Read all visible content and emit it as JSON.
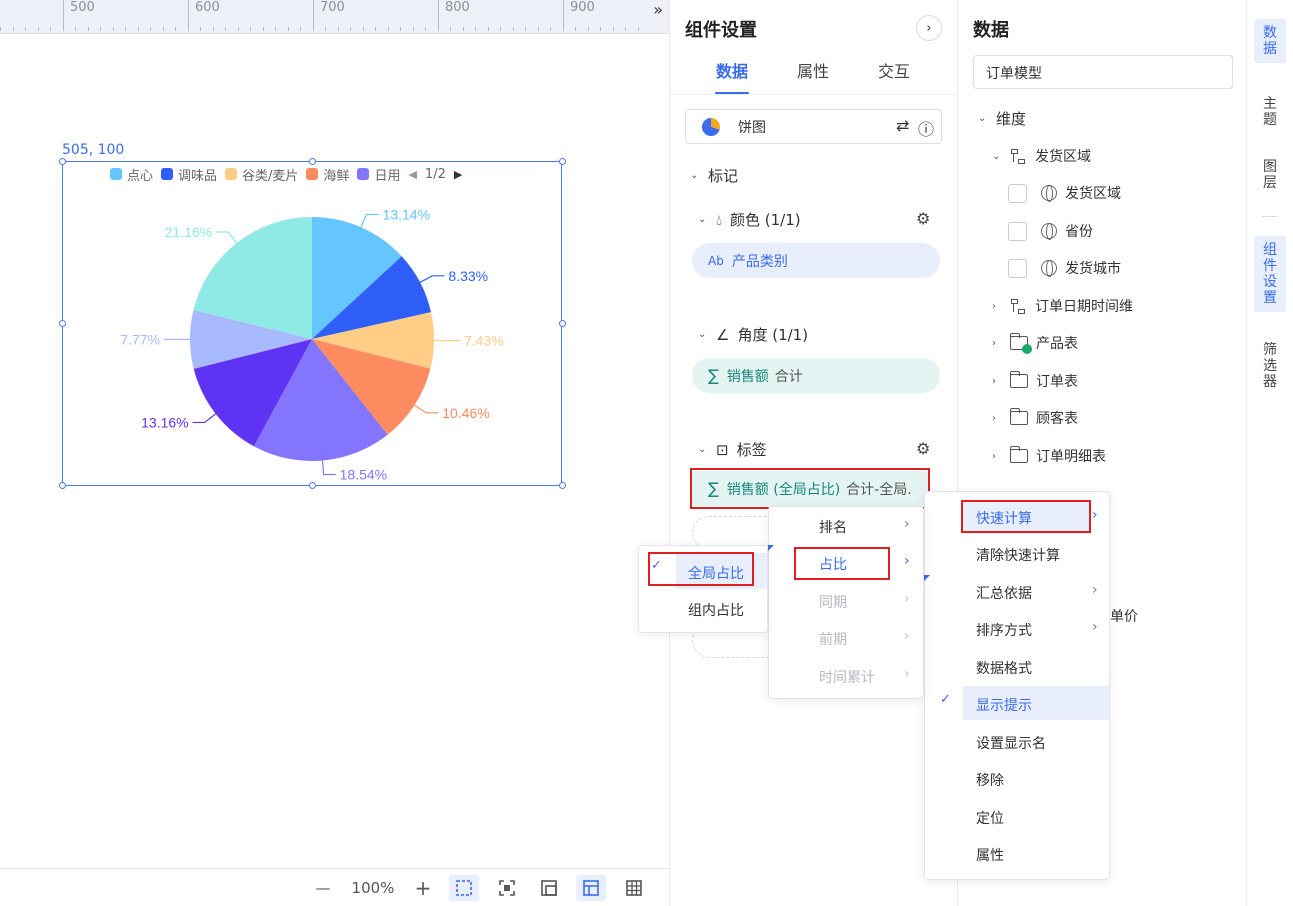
{
  "ruler": {
    "labels": [
      "500",
      "600",
      "700",
      "800",
      "900"
    ],
    "collapse_label": "»"
  },
  "canvas": {
    "selection_coords": "505, 100",
    "legend": {
      "items": [
        {
          "label": "点心",
          "color": "#64c6fd"
        },
        {
          "label": "调味品",
          "color": "#2f5ff8"
        },
        {
          "label": "谷类/麦片",
          "color": "#ffcd85"
        },
        {
          "label": "海鲜",
          "color": "#ff8c60"
        },
        {
          "label": "日用",
          "color": "#8475fd"
        }
      ],
      "page": "1/2"
    }
  },
  "chart_data": {
    "type": "pie",
    "values": [
      13.14,
      8.33,
      7.43,
      10.46,
      18.54,
      13.16,
      7.77,
      21.16
    ],
    "labels": [
      "13.14%",
      "8.33%",
      "7.43%",
      "10.46%",
      "18.54%",
      "13.16%",
      "7.77%",
      "21.16%"
    ],
    "colors": [
      "#64c6fd",
      "#2f5ff8",
      "#ffcd85",
      "#ff8c60",
      "#8475fd",
      "#5f33f4",
      "#a9b9fd",
      "#8fe9e5"
    ],
    "legend_placement": "top"
  },
  "bottombar": {
    "zoom": "100%",
    "minus": "—",
    "plus": "+"
  },
  "component_panel": {
    "title": "组件设置",
    "collapse": "›",
    "tabs": [
      "数据",
      "属性",
      "交互"
    ],
    "chart_type": "饼图",
    "marks_label": "标记",
    "color_section": "颜色 (1/1)",
    "color_field": "产品类别",
    "color_field_prefix": "Ab",
    "angle_section": "角度 (1/1)",
    "angle_field": "销售额",
    "angle_agg": "合计",
    "label_section": "标签",
    "label_field": "销售额 (全局占比)",
    "label_agg": "合计-全局."
  },
  "data_panel": {
    "title": "数据",
    "model": "订单模型",
    "dimension": "维度",
    "tree": [
      {
        "label": "发货区域"
      },
      {
        "label": "发货区域"
      },
      {
        "label": "省份"
      },
      {
        "label": "发货城市"
      },
      {
        "label": "订单日期时间维"
      },
      {
        "label": "产品表"
      },
      {
        "label": "订单表"
      },
      {
        "label": "顾客表"
      },
      {
        "label": "订单明细表"
      }
    ],
    "partial_field": "均单价"
  },
  "strip": [
    "数据",
    "主题",
    "图层",
    "组件设置",
    "筛选器"
  ],
  "menus": {
    "main": [
      "快速计算",
      "清除快速计算",
      "汇总依据",
      "排序方式",
      "数据格式",
      "显示提示",
      "设置显示名",
      "移除",
      "定位",
      "属性"
    ],
    "quick_calc": [
      "排名",
      "占比",
      "同期",
      "前期",
      "时间累计"
    ],
    "share": [
      "全局占比",
      "组内占比"
    ]
  }
}
